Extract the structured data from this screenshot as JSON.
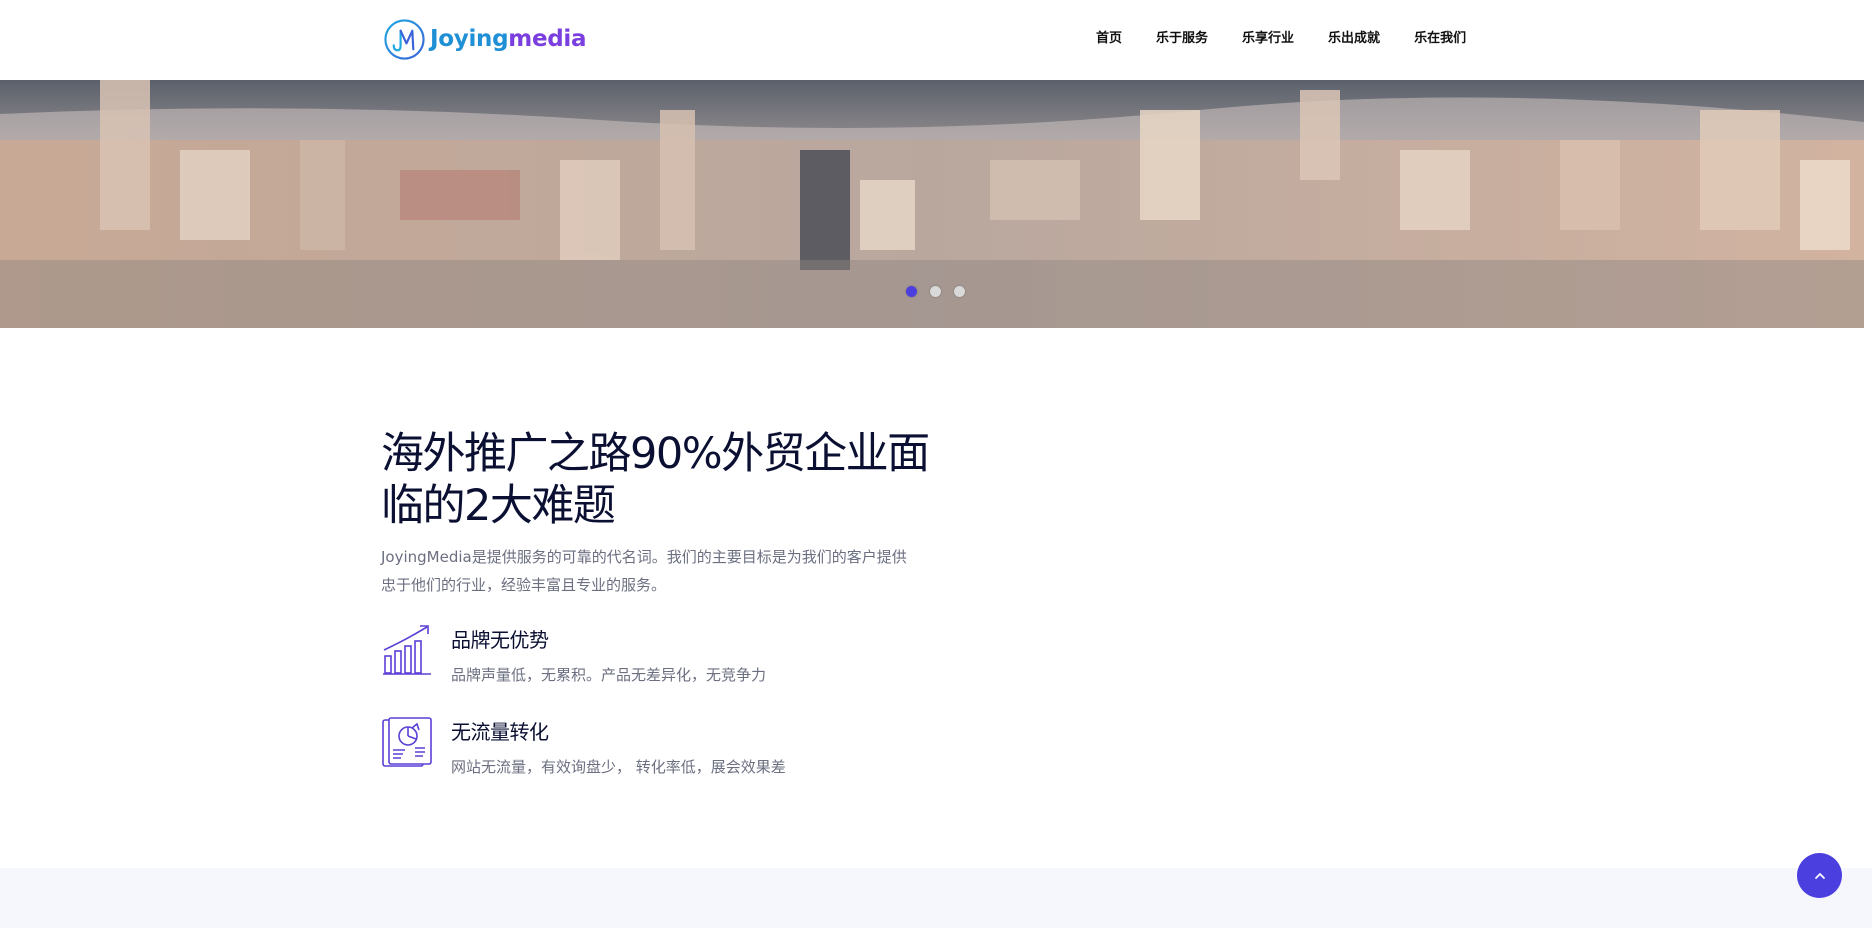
{
  "header": {
    "logo": {
      "icon": "jm-logo-icon",
      "text_part1": "Joying",
      "text_part2": "media"
    },
    "nav": [
      {
        "label": "首页"
      },
      {
        "label": "乐于服务"
      },
      {
        "label": "乐享行业"
      },
      {
        "label": "乐出成就"
      },
      {
        "label": "乐在我们"
      }
    ]
  },
  "hero": {
    "image": "aerial-city-coastline-photo",
    "slides": {
      "count": 3,
      "active": 1
    }
  },
  "intro": {
    "title_line1": "海外推广之路90%外贸企业面",
    "title_line2": "临的2大难题",
    "description": "JoyingMedia是提供服务的可靠的代名词。我们的主要目标是为我们的客户提供忠于他们的行业，经验丰富且专业的服务。",
    "features": [
      {
        "icon": "growth-chart-icon",
        "title": "品牌无优势",
        "text": "品牌声量低，无累积。产品无差异化，无竞争力"
      },
      {
        "icon": "report-document-icon",
        "title": "无流量转化",
        "text": "网站无流量，有效询盘少， 转化率低，展会效果差"
      }
    ]
  },
  "back_to_top": {
    "icon": "chevron-up-icon"
  },
  "colors": {
    "accent": "#4c3fe0",
    "title": "#0b1033",
    "muted": "#6b6f80",
    "band": "#f5f7fd"
  }
}
